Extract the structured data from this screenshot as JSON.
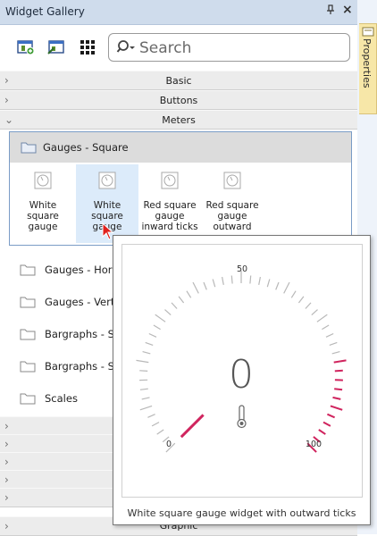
{
  "window": {
    "title": "Widget Gallery",
    "pin_glyph": "ᵖ",
    "close_glyph": "×"
  },
  "toolbar": {
    "buttons": [
      "add-widget-icon",
      "edit-widget-icon",
      "grid-view-icon"
    ],
    "search_placeholder": "Search"
  },
  "sections": [
    {
      "label": "Basic",
      "expanded": false
    },
    {
      "label": "Buttons",
      "expanded": false
    },
    {
      "label": "Meters",
      "expanded": true
    }
  ],
  "group": {
    "title": "Gauges - Square",
    "widgets": [
      {
        "label": "White\nsquare\ngauge",
        "selected": false
      },
      {
        "label": "White\nsquare\ngauge",
        "selected": true
      },
      {
        "label": "Red square\ngauge\ninward ticks",
        "selected": false
      },
      {
        "label": "Red square\ngauge\noutward",
        "selected": false
      }
    ]
  },
  "folders": [
    {
      "label": "Gauges - Horizo"
    },
    {
      "label": "Gauges - Vertic"
    },
    {
      "label": "Bargraphs - Sta"
    },
    {
      "label": "Bargraphs - Se"
    },
    {
      "label": "Scales"
    }
  ],
  "collapsed_sections_bottom": [
    {
      "label": ""
    },
    {
      "label": ""
    },
    {
      "label": ""
    },
    {
      "label": ""
    },
    {
      "label": ""
    },
    {
      "label": "Graphic"
    }
  ],
  "side_tab": {
    "label": "Properties"
  },
  "tooltip": {
    "caption": "White square gauge widget with outward ticks",
    "gauge": {
      "value": "0",
      "min_label": "0",
      "mid_label": "50",
      "max_label": "100",
      "accent_color": "#d0245e"
    }
  }
}
